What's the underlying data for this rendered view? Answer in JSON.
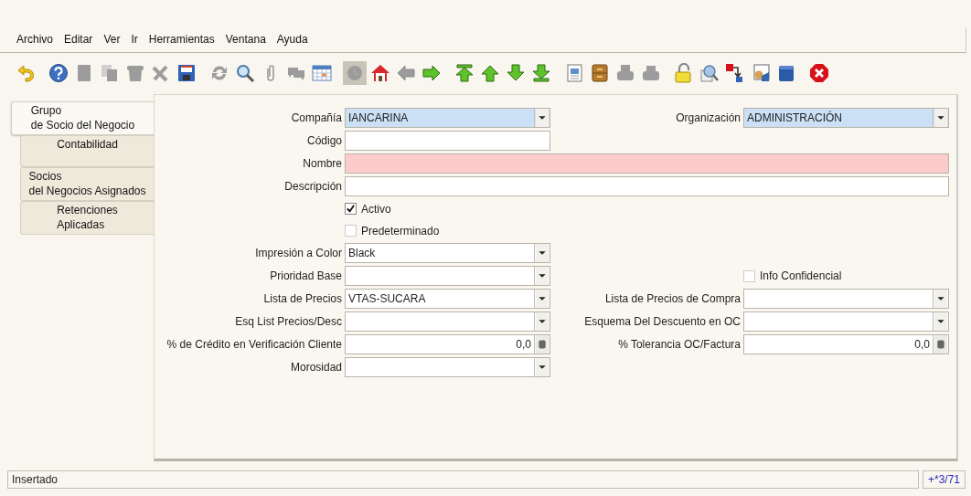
{
  "menu": [
    {
      "label": "Archivo"
    },
    {
      "label": "Editar"
    },
    {
      "label": "Ver"
    },
    {
      "label": "Ir"
    },
    {
      "label": "Herramientas"
    },
    {
      "label": "Ventana"
    },
    {
      "label": "Ayuda"
    }
  ],
  "toolbar": [
    [
      {
        "kind": "undo",
        "disabled": false,
        "pressed": false
      }
    ],
    [
      {
        "kind": "help",
        "disabled": false,
        "pressed": false
      },
      {
        "kind": "new",
        "disabled": true,
        "pressed": false
      },
      {
        "kind": "copy",
        "disabled": true,
        "pressed": false
      },
      {
        "kind": "delete",
        "disabled": true,
        "pressed": false
      },
      {
        "kind": "delete_selection",
        "disabled": true,
        "pressed": false
      },
      {
        "kind": "save",
        "disabled": false,
        "pressed": false
      }
    ],
    [
      {
        "kind": "refresh",
        "disabled": true,
        "pressed": false
      },
      {
        "kind": "find",
        "disabled": false,
        "pressed": false
      },
      {
        "kind": "attach",
        "disabled": true,
        "pressed": false
      },
      {
        "kind": "chat",
        "disabled": true,
        "pressed": false
      },
      {
        "kind": "calendar",
        "disabled": false,
        "pressed": false
      }
    ],
    [
      {
        "kind": "history",
        "disabled": true,
        "pressed": true
      },
      {
        "kind": "home",
        "disabled": false,
        "pressed": false
      },
      {
        "kind": "previous",
        "disabled": true,
        "pressed": false
      },
      {
        "kind": "next",
        "disabled": false,
        "pressed": false
      }
    ],
    [
      {
        "kind": "first",
        "disabled": false,
        "pressed": false
      },
      {
        "kind": "up",
        "disabled": false,
        "pressed": false
      },
      {
        "kind": "down",
        "disabled": false,
        "pressed": false
      },
      {
        "kind": "last",
        "disabled": false,
        "pressed": false
      }
    ],
    [
      {
        "kind": "report",
        "disabled": false,
        "pressed": false
      },
      {
        "kind": "archive",
        "disabled": false,
        "pressed": false
      },
      {
        "kind": "print_preview",
        "disabled": true,
        "pressed": false
      },
      {
        "kind": "print",
        "disabled": true,
        "pressed": false
      }
    ],
    [
      {
        "kind": "lock",
        "disabled": false,
        "pressed": false
      },
      {
        "kind": "zoom_across",
        "disabled": false,
        "pressed": false
      },
      {
        "kind": "workflow",
        "disabled": false,
        "pressed": false
      },
      {
        "kind": "request",
        "disabled": false,
        "pressed": false
      },
      {
        "kind": "product",
        "disabled": false,
        "pressed": false
      }
    ],
    [
      {
        "kind": "exit",
        "disabled": false,
        "pressed": false
      }
    ]
  ],
  "tabs": [
    {
      "label": "Grupo\nde Socio del Negocio",
      "selected": true
    },
    {
      "label": "Contabilidad",
      "selected": false
    },
    {
      "label": "Socios\ndel Negocios Asignados",
      "selected": false
    },
    {
      "label": "Retenciones\nAplicadas",
      "selected": false
    }
  ],
  "form": {
    "rows": [
      {
        "left": {
          "kind": "combo",
          "label": "Compañía",
          "value": "IANCARINA",
          "readonly": true
        },
        "right": {
          "kind": "combo",
          "label": "Organización",
          "value": "ADMINISTRACIÓN",
          "readonly": true
        }
      },
      {
        "left": {
          "kind": "text",
          "label": "Código",
          "readonly": false,
          "mandatory": false,
          "wide": false
        }
      },
      {
        "left": {
          "kind": "text",
          "label": "Nombre",
          "readonly": false,
          "mandatory": true,
          "wide": true
        }
      },
      {
        "left": {
          "kind": "text",
          "label": "Descripción",
          "readonly": false,
          "mandatory": false,
          "wide": true
        }
      },
      {
        "left": {
          "kind": "checkbox",
          "label": "Activo",
          "checked": true
        }
      },
      {
        "left": {
          "kind": "checkbox",
          "label": "Predeterminado",
          "checked": false
        }
      },
      {
        "left": {
          "kind": "combo",
          "label": "Impresión a Color",
          "value": "Black",
          "readonly": false,
          "mandatory": false
        }
      },
      {
        "left": {
          "kind": "combo",
          "label": "Prioridad Base",
          "readonly": false,
          "mandatory": false
        },
        "right": {
          "kind": "checkbox",
          "label": "Info Confidencial",
          "checked": false
        }
      },
      {
        "left": {
          "kind": "combo",
          "label": "Lista de Precios",
          "value": "VTAS-SUCARA",
          "readonly": false,
          "mandatory": false
        },
        "right": {
          "kind": "combo",
          "label": "Lista de Precios de Compra",
          "readonly": false,
          "mandatory": false
        }
      },
      {
        "left": {
          "kind": "combo",
          "label": "Esq List Precios/Desc",
          "readonly": false,
          "mandatory": false
        },
        "right": {
          "kind": "combo",
          "label": "Esquema Del Descuento en OC",
          "readonly": false,
          "mandatory": false
        }
      },
      {
        "left": {
          "kind": "number",
          "label": "% de Crédito en Verificación Cliente",
          "value": "0,0",
          "readonly": false,
          "mandatory": false
        },
        "right": {
          "kind": "number",
          "label": "% Tolerancia OC/Factura",
          "value": "0,0",
          "readonly": false,
          "mandatory": false
        }
      },
      {
        "left": {
          "kind": "combo",
          "label": "Morosidad",
          "readonly": false,
          "mandatory": false
        }
      }
    ]
  },
  "status_bar": {
    "message": "Insertado",
    "record": "+*3/71"
  }
}
